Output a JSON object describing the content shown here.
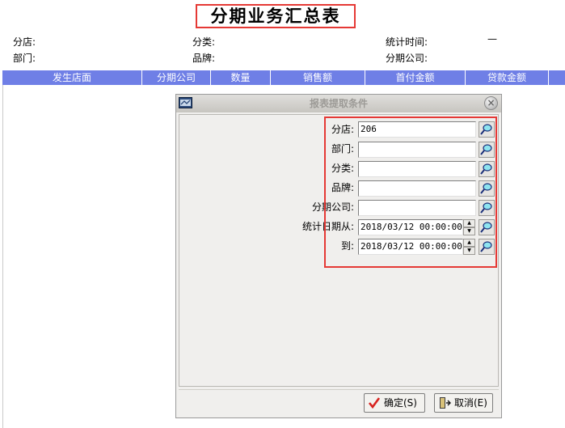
{
  "report": {
    "title": "分期业务汇总表",
    "branch_label": "分店:",
    "department_label": "部门:",
    "category_label": "分类:",
    "brand_label": "品牌:",
    "stat_time_label": "统计时间:",
    "stat_time_value": "—",
    "installment_company_label": "分期公司:"
  },
  "table": {
    "columns": [
      "发生店面",
      "分期公司",
      "数量",
      "销售额",
      "首付金额",
      "贷款金额"
    ]
  },
  "dialog": {
    "title": "报表提取条件",
    "close_symbol": "×",
    "fields": {
      "branch": {
        "label": "分店:",
        "value": "206"
      },
      "department": {
        "label": "部门:",
        "value": ""
      },
      "category": {
        "label": "分类:",
        "value": ""
      },
      "brand": {
        "label": "品牌:",
        "value": ""
      },
      "installment_company": {
        "label": "分期公司:",
        "value": ""
      },
      "date_from": {
        "label": "统计日期从:",
        "value": "2018/03/12 00:00:00"
      },
      "date_to": {
        "label": "到:",
        "value": "2018/03/12 00:00:00"
      }
    },
    "spin_up": "▲",
    "spin_down": "▼",
    "ok_label": "确定(S)",
    "cancel_label": "取消(E)"
  },
  "colors": {
    "header_bg": "#6f7fe6",
    "highlight": "#e53935",
    "dialog_bg": "#f0efed"
  },
  "icons": [
    "dialog-app-icon",
    "search-icon",
    "checkmark-icon",
    "exit-door-icon",
    "close-icon"
  ]
}
